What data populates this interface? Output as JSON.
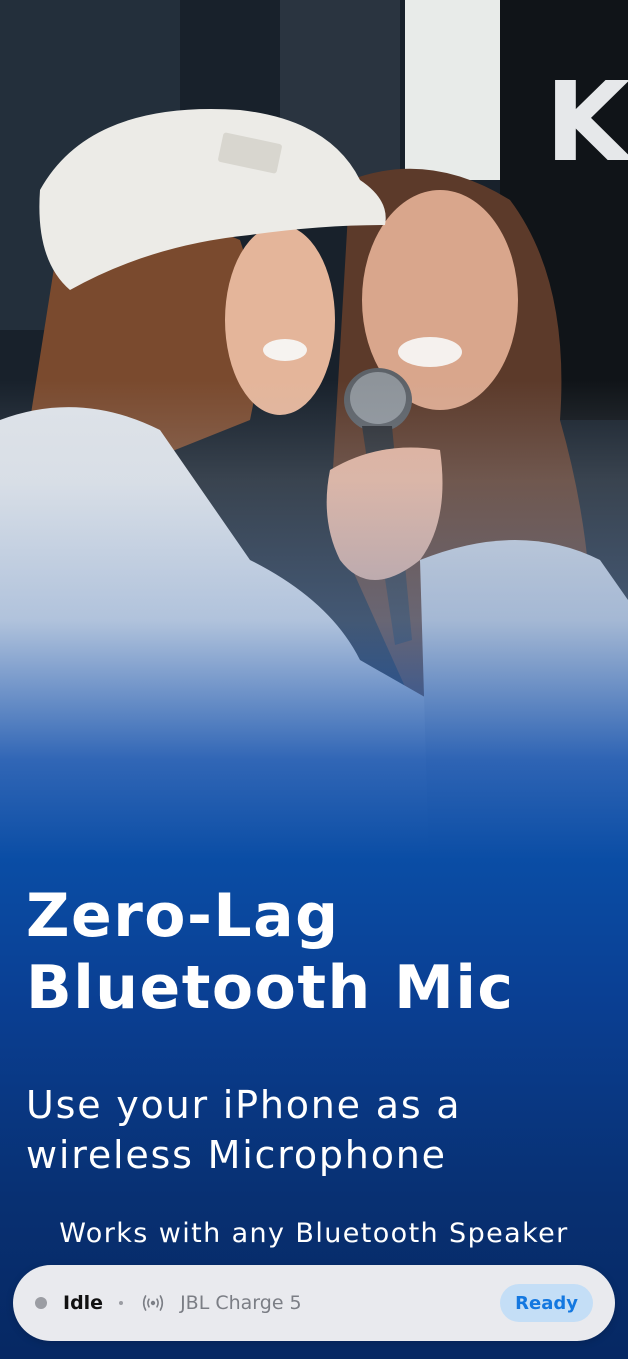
{
  "hero": {
    "title_line1": "Zero-Lag",
    "title_line2": "Bluetooth Mic",
    "subtitle_line1": "Use your iPhone as a",
    "subtitle_line2": "wireless Microphone",
    "note": "Works with any Bluetooth Speaker"
  },
  "status": {
    "state_label": "Idle",
    "state_color": "#9b9da3",
    "icon": "broadcast-icon",
    "device_name": "JBL Charge 5",
    "badge_label": "Ready",
    "badge_color": "#1478e0"
  },
  "colors": {
    "accent_blue": "#0a4da5",
    "deep_blue": "#062863"
  }
}
